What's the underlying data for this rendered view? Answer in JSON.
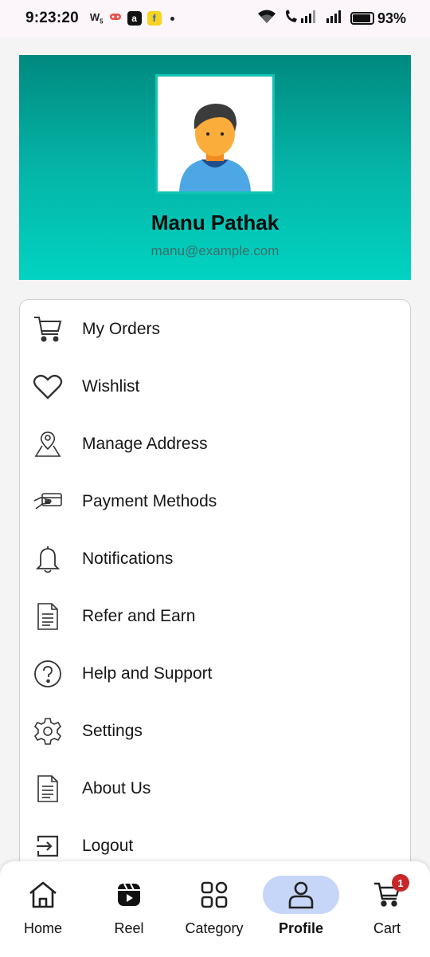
{
  "status_bar": {
    "time": "9:23:20",
    "left_icons": [
      "whatsapp-icon",
      "game-icon",
      "amazon-icon",
      "flipkart-icon",
      "dot-icon"
    ],
    "battery_percent": "93%",
    "battery_level": 0.93
  },
  "profile": {
    "name": "Manu Pathak",
    "email": "manu@example.com"
  },
  "menu": {
    "items": [
      {
        "label": "My Orders",
        "icon": "cart-icon"
      },
      {
        "label": "Wishlist",
        "icon": "heart-icon"
      },
      {
        "label": "Manage Address",
        "icon": "location-pin-icon"
      },
      {
        "label": "Payment Methods",
        "icon": "payment-card-icon"
      },
      {
        "label": "Notifications",
        "icon": "bell-icon"
      },
      {
        "label": "Refer and Earn",
        "icon": "document-icon"
      },
      {
        "label": "Help and Support",
        "icon": "help-icon"
      },
      {
        "label": "Settings",
        "icon": "gear-icon"
      },
      {
        "label": "About Us",
        "icon": "document-icon"
      },
      {
        "label": "Logout",
        "icon": "logout-icon"
      }
    ]
  },
  "bottom_nav": {
    "items": [
      {
        "label": "Home",
        "icon": "home-icon"
      },
      {
        "label": "Reel",
        "icon": "reel-icon"
      },
      {
        "label": "Category",
        "icon": "grid-icon"
      },
      {
        "label": "Profile",
        "icon": "person-icon",
        "active": true
      },
      {
        "label": "Cart",
        "icon": "cart-icon",
        "badge": "1"
      }
    ]
  },
  "colors": {
    "header_top": "#00897f",
    "header_bottom": "#02d3c2",
    "active_pill": "#c5d6f8",
    "badge": "#c62828"
  }
}
